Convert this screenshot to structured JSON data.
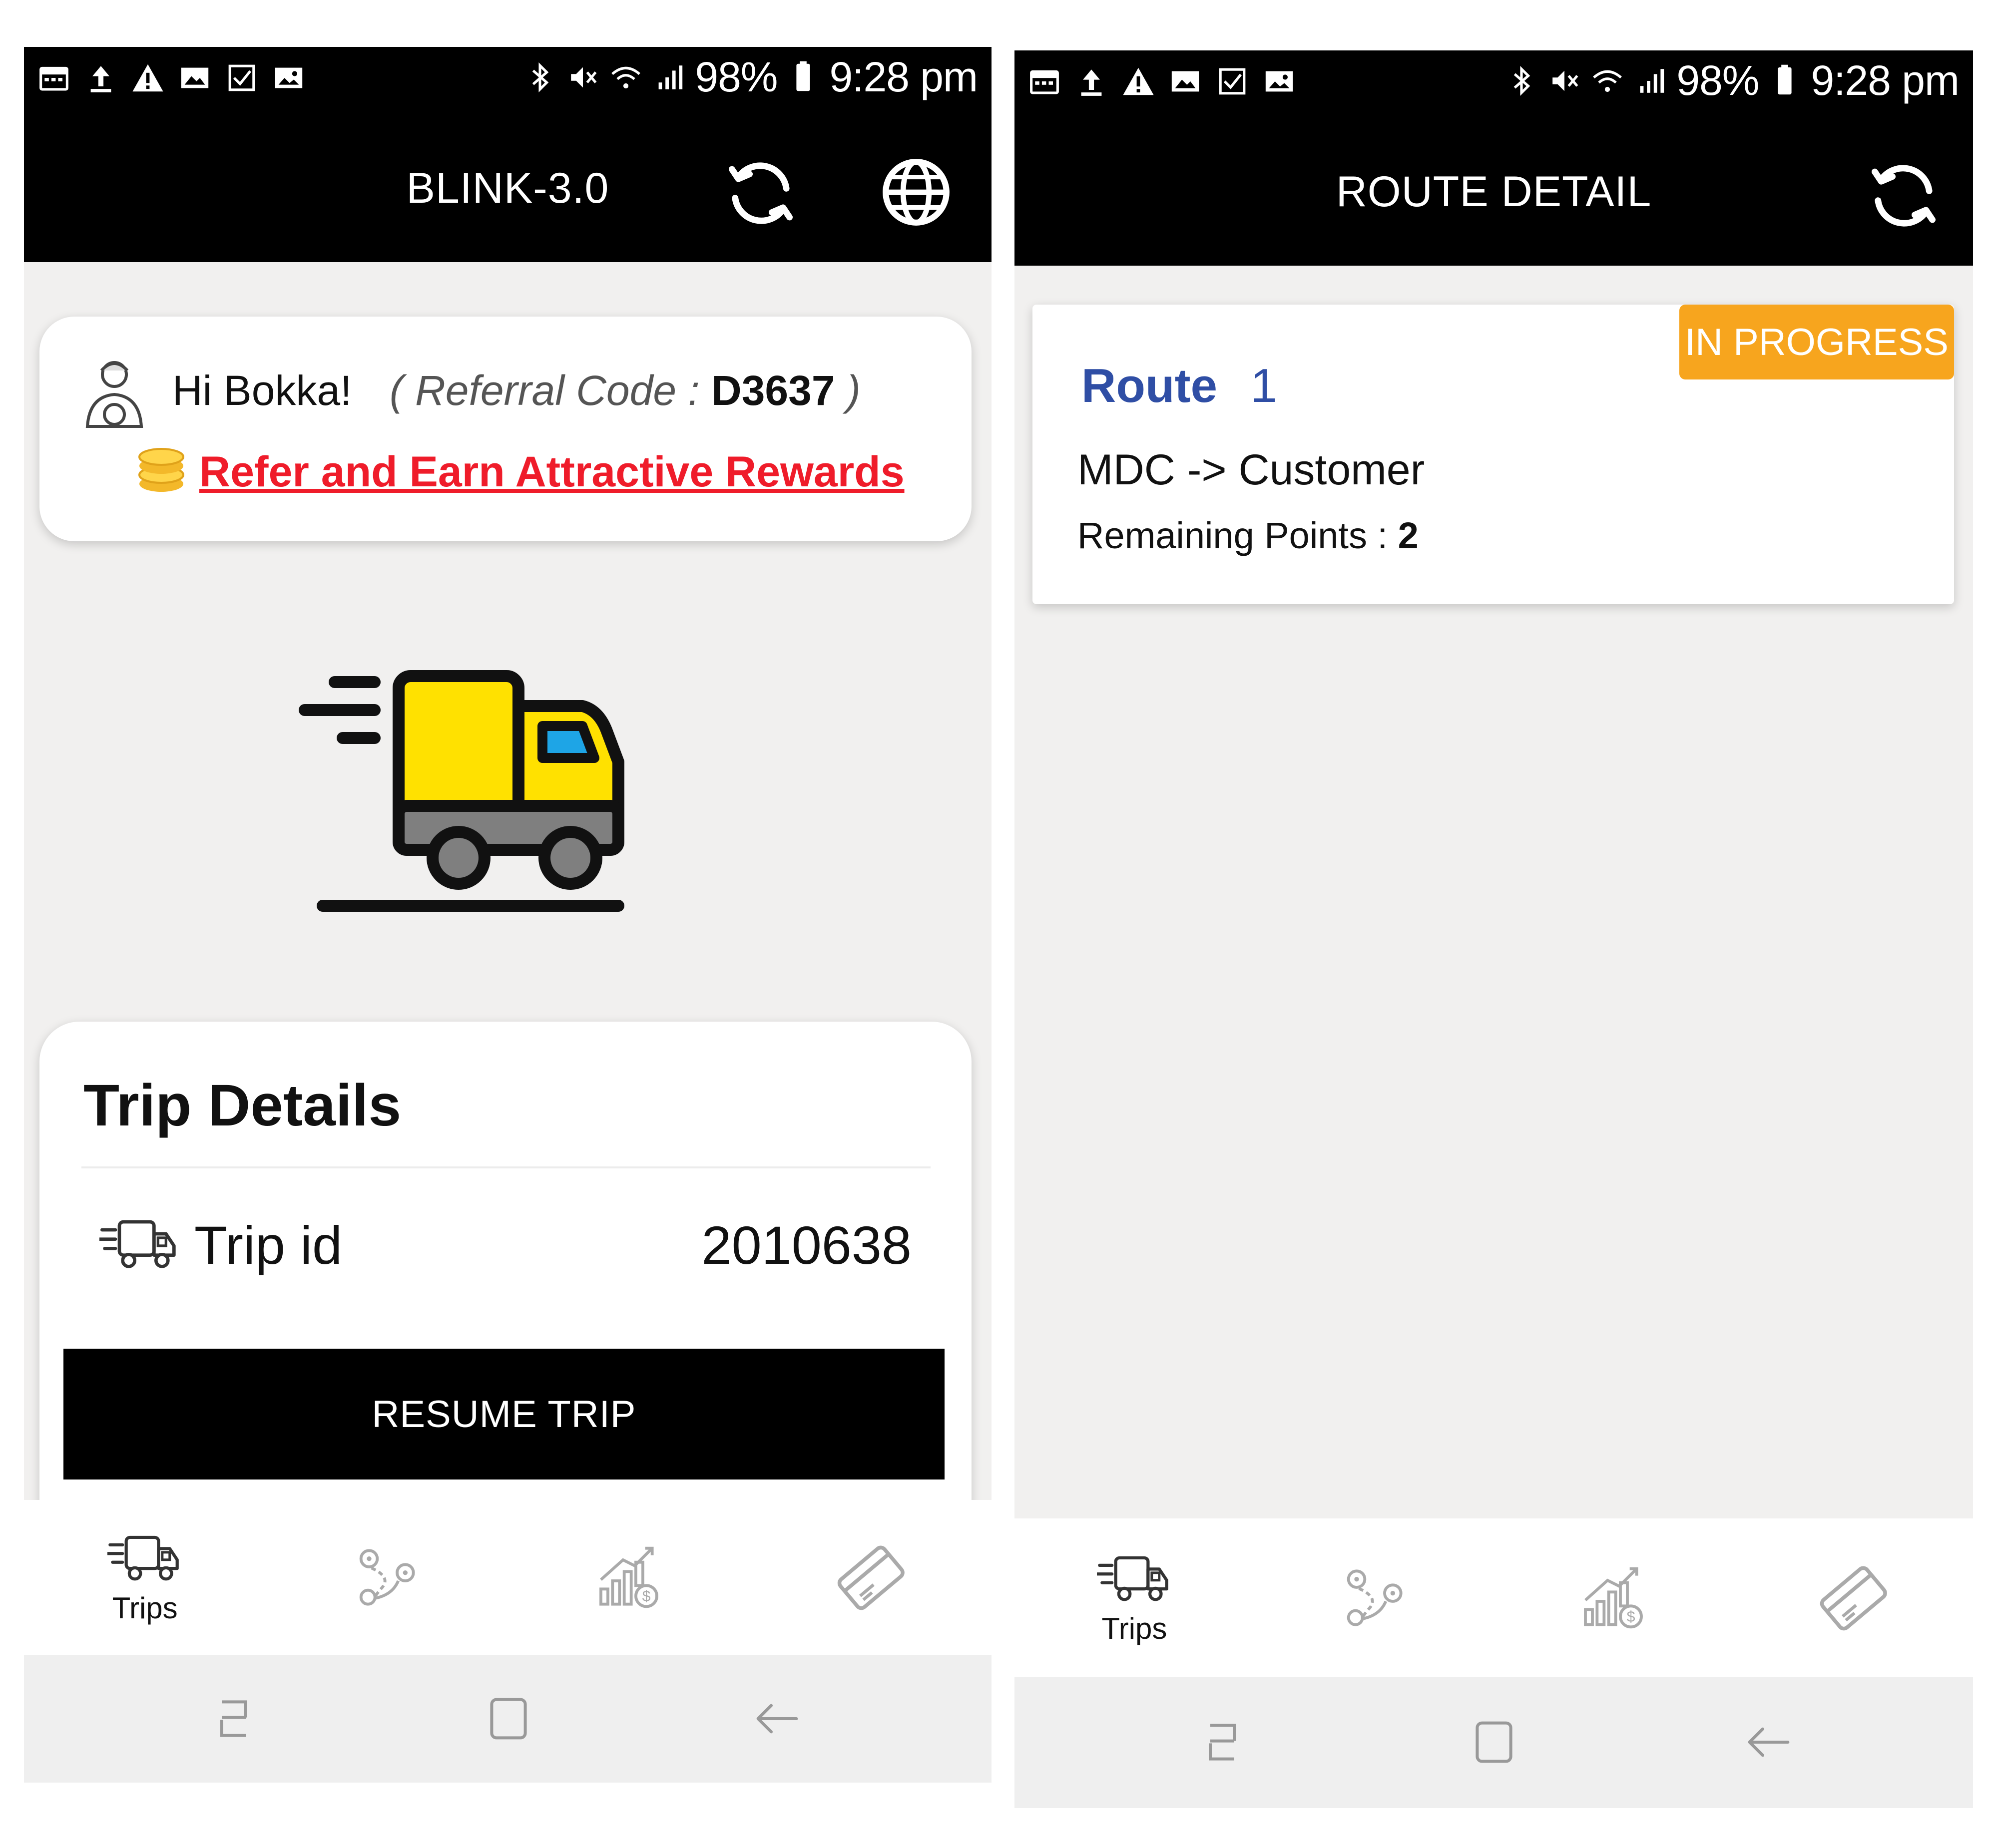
{
  "status_bar": {
    "battery": "98%",
    "time": "9:28 pm"
  },
  "home": {
    "app_title": "BLINK-3.0",
    "greeting": "Hi Bokka!",
    "referral_prefix": "( Referral Code : ",
    "referral_code": "D3637",
    "referral_suffix": " )",
    "refer_link": "Refer and Earn Attractive Rewards",
    "trip_details_title": "Trip Details",
    "trip_id_label": "Trip id",
    "trip_id_value": "2010638",
    "resume_button": "RESUME TRIP",
    "icons": [
      "sync-icon",
      "globe-icon",
      "driver-avatar-icon",
      "coins-icon",
      "delivery-truck-illustration"
    ]
  },
  "route_detail": {
    "title": "ROUTE DETAIL",
    "status_badge": "IN PROGRESS",
    "route_label": "Route",
    "route_number": "1",
    "route_path": "MDC -> Customer",
    "remaining_label": "Remaining Points : ",
    "remaining_value": "2"
  },
  "bottom_nav": {
    "items": [
      {
        "label": "Trips",
        "icon": "truck-icon",
        "active": true
      },
      {
        "label": "",
        "icon": "route-map-icon",
        "active": false
      },
      {
        "label": "",
        "icon": "earnings-chart-icon",
        "active": false
      },
      {
        "label": "",
        "icon": "card-icon",
        "active": false
      }
    ]
  },
  "system_nav": {
    "icons": [
      "recent-apps-icon",
      "home-icon",
      "back-icon"
    ]
  },
  "colors": {
    "bar": "#000000",
    "background": "#f1f0ef",
    "accent_red": "#ef1c2a",
    "badge": "#f7a51e",
    "route_blue": "#2f4ea5",
    "truck_yellow": "#ffe100"
  }
}
